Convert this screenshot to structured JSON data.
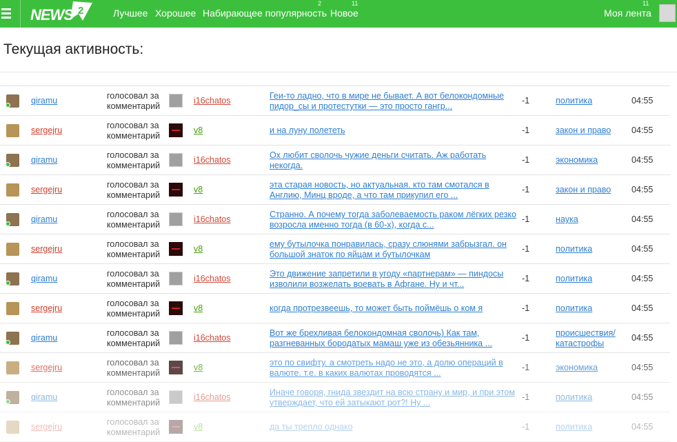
{
  "header": {
    "logo_text": "NEWS",
    "logo_badge": "2",
    "nav": [
      {
        "label": "Лучшее",
        "count": ""
      },
      {
        "label": "Хорошее",
        "count": ""
      },
      {
        "label": "Набирающее популярность",
        "count": "2"
      },
      {
        "label": "Новое",
        "count": "11"
      }
    ],
    "my_feed": {
      "label": "Моя лента",
      "count": "11"
    },
    "accent": "#3dbf3e"
  },
  "page_title": "Текущая активность:",
  "rows": [
    {
      "user": "qiramu",
      "action": "голосовал за комментарий",
      "target": "i16chatos",
      "comment": "Геи-то ладно, что в мире не бывает. А вот белокондомные пидор_сы и протестутки — это просто гангр...",
      "vote": "-1",
      "category": "политика",
      "time": "04:55"
    },
    {
      "user": "sergejru",
      "action": "голосовал за комментарий",
      "target": "v8",
      "comment": " и на луну полететь",
      "vote": "-1",
      "category": "закон и право",
      "time": "04:55"
    },
    {
      "user": "qiramu",
      "action": "голосовал за комментарий",
      "target": "i16chatos",
      "comment": "Ох любит сволочь чужие деньги считать. Аж работать некогда.",
      "vote": "-1",
      "category": "экономика",
      "time": "04:55"
    },
    {
      "user": "sergejru",
      "action": "голосовал за комментарий",
      "target": "v8",
      "comment": "эта старая новость, но актуальная. кто там смотался в Англию, Минц вроде, а что там прикупил его ...",
      "vote": "-1",
      "category": "закон и право",
      "time": "04:55"
    },
    {
      "user": "qiramu",
      "action": "голосовал за комментарий",
      "target": "i16chatos",
      "comment": "Странно. А почему тогда заболеваемость раком лёгких резко возросла именно тогда (в 60-х), когда с...",
      "vote": "-1",
      "category": "наука",
      "time": "04:55"
    },
    {
      "user": "sergejru",
      "action": "голосовал за комментарий",
      "target": "v8",
      "comment": " ему бутылочка понравилась, сразу слюнями забрызгал. он большой знаток по яйцам и бутылочкам",
      "vote": "-1",
      "category": "политика",
      "time": "04:55"
    },
    {
      "user": "qiramu",
      "action": "голосовал за комментарий",
      "target": "i16chatos",
      "comment": "Это движение запретили в угоду «партнерам» — пиндосы изволили возжелать воевать в Афгане. Ну и чт...",
      "vote": "-1",
      "category": "политика",
      "time": "04:55"
    },
    {
      "user": "sergejru",
      "action": "голосовал за комментарий",
      "target": "v8",
      "comment": "когда протрезвеешь, то может быть поймёшь о ком я",
      "vote": "-1",
      "category": "политика",
      "time": "04:55"
    },
    {
      "user": "qiramu",
      "action": "голосовал за комментарий",
      "target": "i16chatos",
      "comment": "Вот же брехливая белокондомная сволочь) Как там, разгневанных бородатых мамаш уже из обезьянника ...",
      "vote": "-1",
      "category": "происшествия/ катастрофы",
      "time": "04:55"
    },
    {
      "user": "sergejru",
      "action": "голосовал за комментарий",
      "target": "v8",
      "comment": "это по свифту. а смотреть надо не это, а долю операций в валюте. т.е. в каких валютах проводятся ...",
      "vote": "-1",
      "category": "экономика",
      "time": "04:55"
    },
    {
      "user": "qiramu",
      "action": "голосовал за комментарий",
      "target": "i16chatos",
      "comment": "Иначе говоря, гнида звездит на всю страну и мир, и при этом утверждает, что ей затыкают рот?! Ну ...",
      "vote": "-1",
      "category": "политика",
      "time": "04:55"
    },
    {
      "user": "sergejru",
      "action": "голосовал за комментарий",
      "target": "v8",
      "comment": "да ты трепло однако",
      "vote": "-1",
      "category": "политика",
      "time": "04:55"
    }
  ]
}
